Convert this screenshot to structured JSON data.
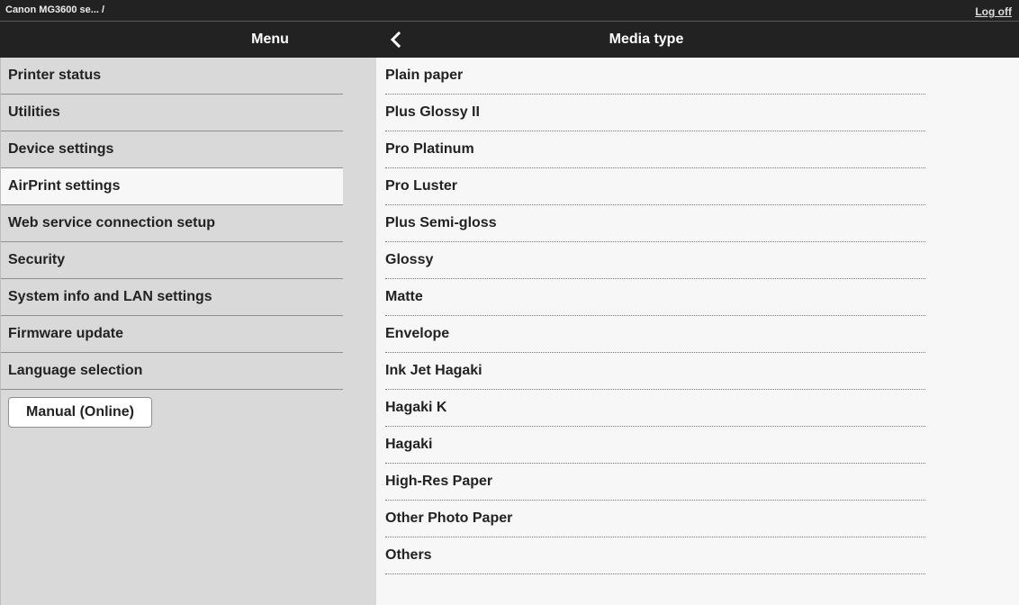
{
  "topbar": {
    "device": "Canon MG3600 se... /",
    "logoff": "Log off"
  },
  "header": {
    "menu_title": "Menu",
    "media_title": "Media type"
  },
  "sidebar": {
    "items": [
      {
        "label": "Printer status"
      },
      {
        "label": "Utilities"
      },
      {
        "label": "Device settings"
      },
      {
        "label": "AirPrint settings",
        "active": true
      },
      {
        "label": "Web service connection setup"
      },
      {
        "label": "Security"
      },
      {
        "label": "System info and LAN settings"
      },
      {
        "label": "Firmware update"
      },
      {
        "label": "Language selection"
      }
    ],
    "manual_button": "Manual (Online)"
  },
  "media_types": [
    "Plain paper",
    "Plus Glossy II",
    "Pro Platinum",
    "Pro Luster",
    "Plus Semi-gloss",
    "Glossy",
    "Matte",
    "Envelope",
    "Ink Jet Hagaki",
    "Hagaki K",
    "Hagaki",
    "High-Res Paper",
    "Other Photo Paper",
    "Others"
  ],
  "icons": {
    "back": "chevron-left-icon"
  }
}
